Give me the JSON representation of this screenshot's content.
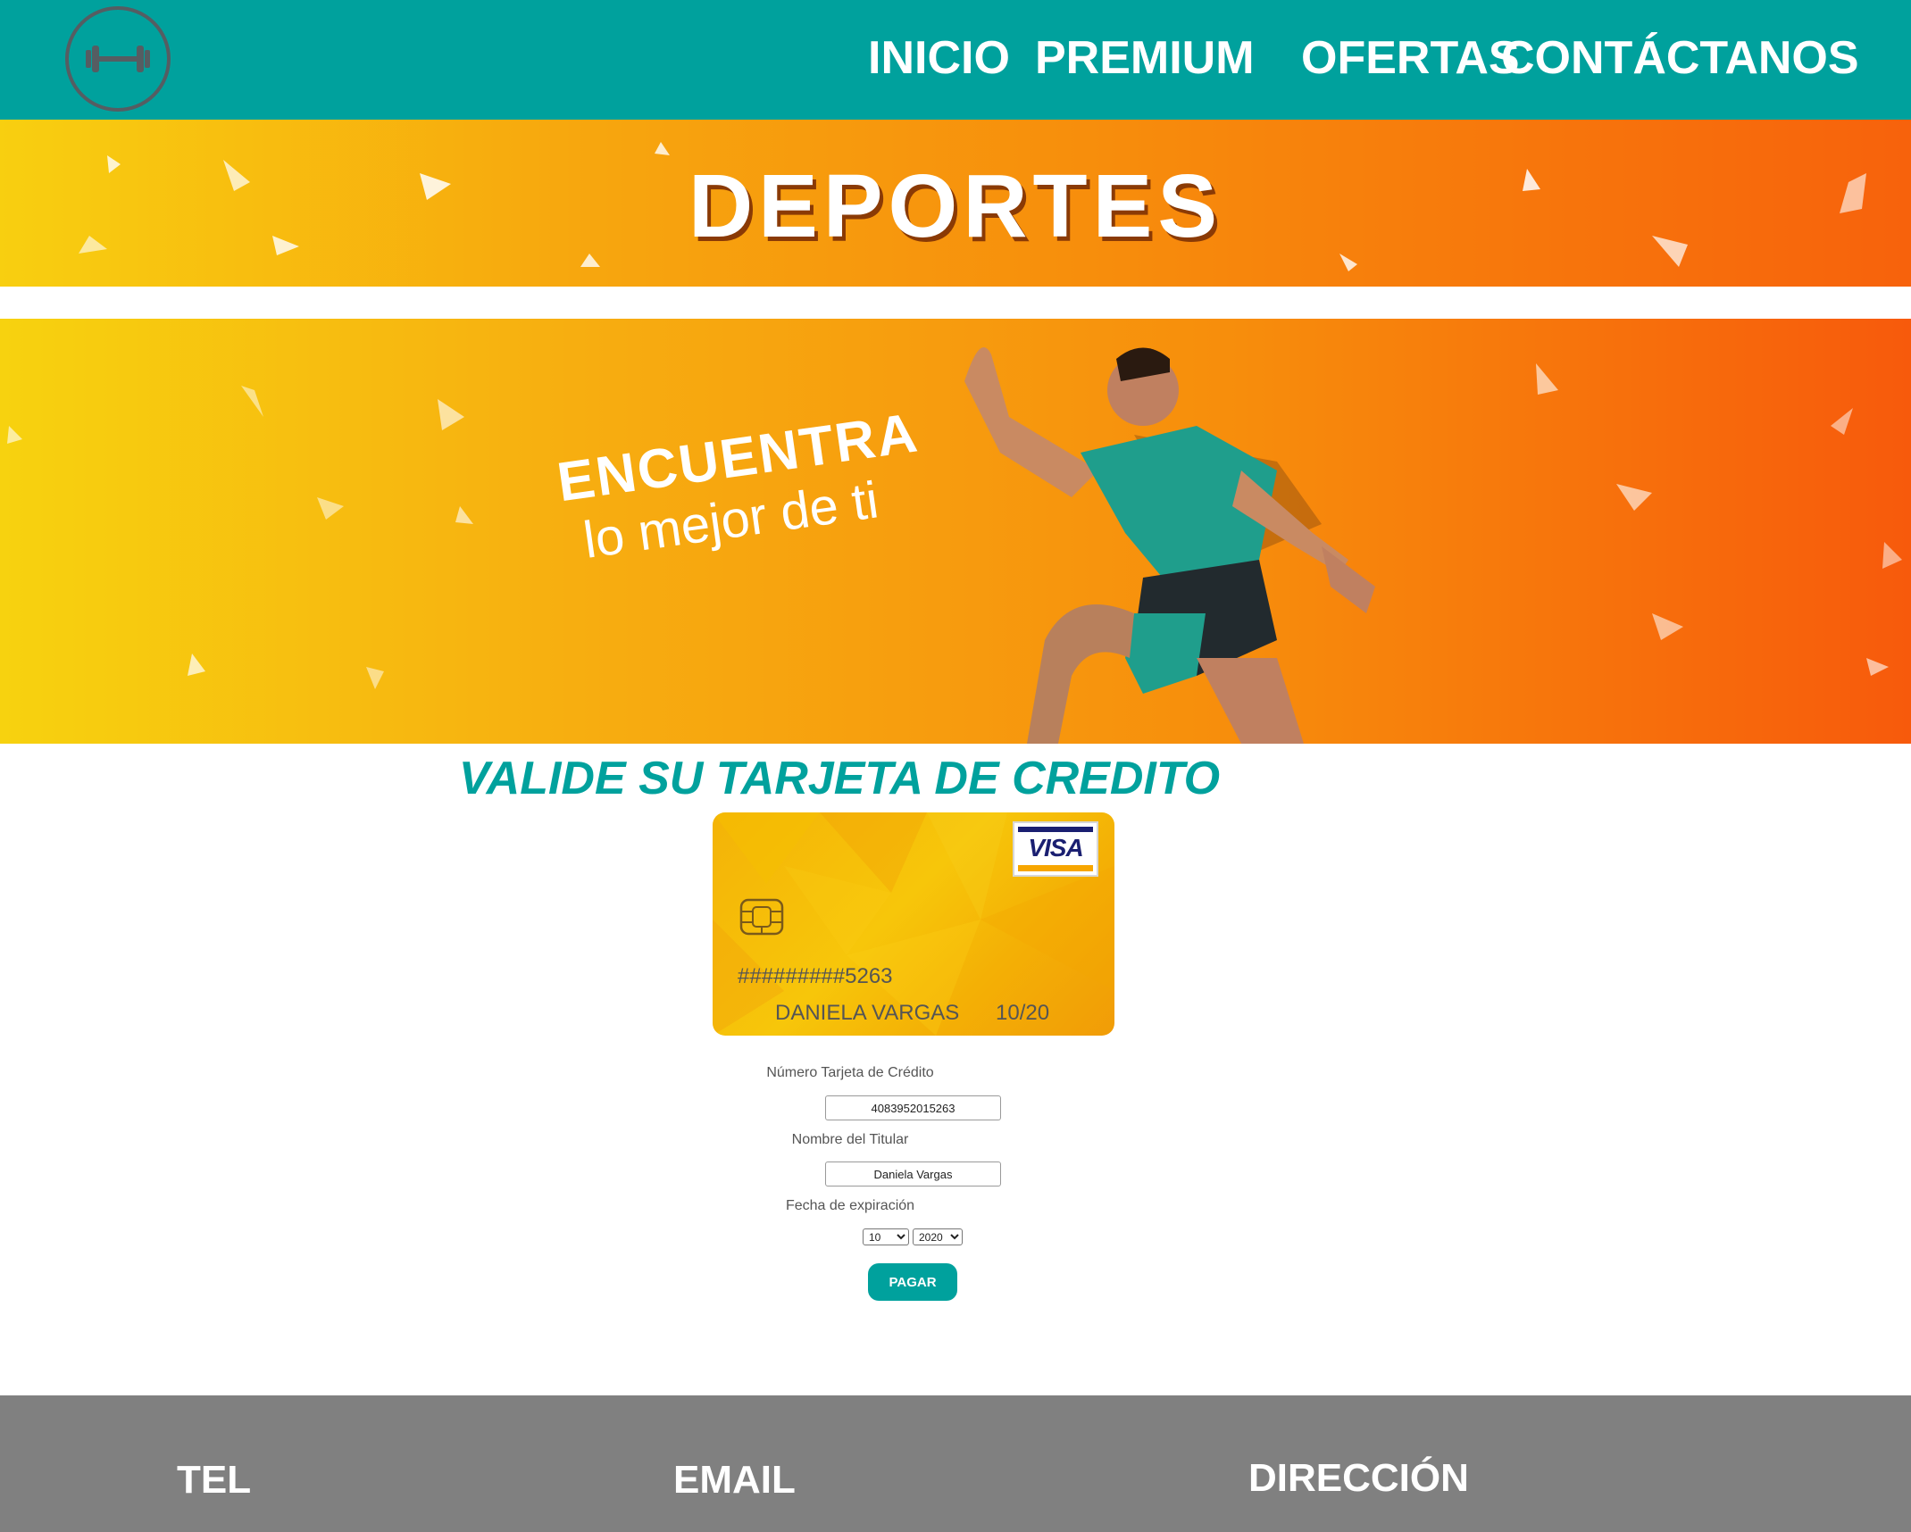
{
  "header": {
    "logo": "dumbbell-icon",
    "menu": [
      "INICIO",
      "PREMIUM",
      "OFERTAS",
      "CONTÁCTANOS"
    ]
  },
  "banner": {
    "title": "DEPORTES",
    "slogan_line1": "ENCUENTRA",
    "slogan_line2": "lo mejor de ti"
  },
  "form": {
    "title": "VALIDE SU TARJETA DE CREDITO",
    "card": {
      "brand": "VISA",
      "masked_number": "#########5263",
      "holder": "DANIELA VARGAS",
      "expiry": "10/20"
    },
    "card_number_label": "Número Tarjeta de Crédito",
    "card_number_value": "4083952015263",
    "holder_label": "Nombre del Titular",
    "holder_value": "Daniela Vargas",
    "expiry_label": "Fecha de expiración",
    "month_value": "10",
    "year_value": "2020",
    "pay_label": "PAGAR"
  },
  "footer": {
    "tel": "TEL",
    "email": "EMAIL",
    "address": "DIRECCIÓN"
  },
  "colors": {
    "teal": "#00a19d",
    "orange": "#f78b0c",
    "footer_gray": "#808080"
  }
}
